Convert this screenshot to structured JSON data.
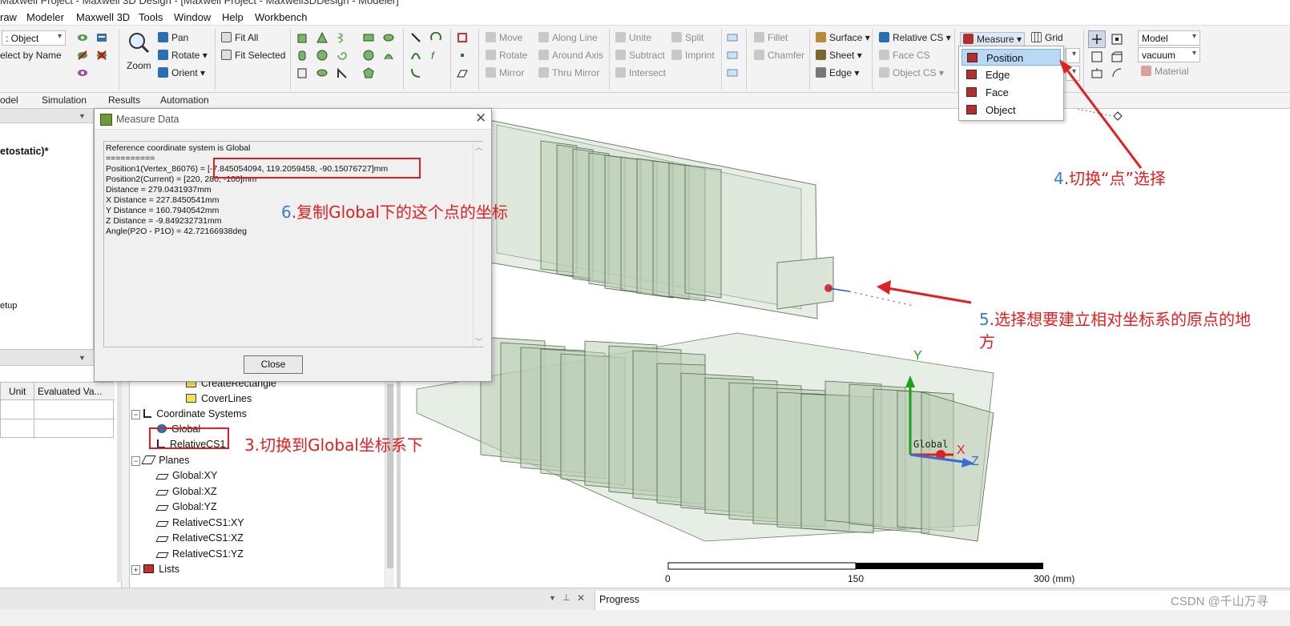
{
  "window": {
    "title": "Maxwell Project - Maxwell 3D Design - [Maxwell Project - Maxwell3DDesign - Modeler]"
  },
  "menu": [
    "raw",
    "Modeler",
    "Maxwell 3D",
    "Tools",
    "Window",
    "Help",
    "Workbench"
  ],
  "ribbon": {
    "select_combo": ": Object",
    "select_by_name": "elect by Name",
    "zoom": "Zoom",
    "pan": "Pan",
    "rotate": "Rotate",
    "orient": "Orient",
    "fit_all": "Fit All",
    "fit_selected": "Fit Selected",
    "move": "Move",
    "rotate2": "Rotate",
    "mirror": "Mirror",
    "along_line": "Along Line",
    "around_axis": "Around Axis",
    "thru_mirror": "Thru Mirror",
    "unite": "Unite",
    "subtract": "Subtract",
    "intersect": "Intersect",
    "split": "Split",
    "imprint": "Imprint",
    "fillet": "Fillet",
    "chamfer": "Chamfer",
    "surface": "Surface",
    "sheet": "Sheet",
    "edge": "Edge",
    "relative_cs": "Relative CS",
    "face_cs": "Face CS",
    "object_cs": "Object CS",
    "measure": "Measure",
    "grid": "Grid",
    "model_combo": "Model",
    "material_combo": "vacuum",
    "material": "Material"
  },
  "tabs": [
    "odel",
    "Simulation",
    "Results",
    "Automation"
  ],
  "left_panel": {
    "project_fragment": "etostatic)*",
    "setup_fragment": "etup",
    "table_headers": [
      "Unit",
      "Evaluated Va..."
    ]
  },
  "measure_dialog": {
    "title": "Measure Data",
    "lines": [
      "Reference coordinate system is Global",
      "==========",
      "Position1(Vertex_86076) = [-7.845054094, 119.2059458, -90.15076727]mm",
      "Position2(Current) = [220, 280, -100]mm",
      "Distance = 279.0431937mm",
      "X Distance = 227.8450541mm",
      "Y Distance = 160.7940542mm",
      "Z Distance = -9.849232731mm",
      "Angle(P2O - P1O) = 42.72166938deg"
    ],
    "close": "Close"
  },
  "measure_menu": {
    "items": [
      "Position",
      "Edge",
      "Face",
      "Object"
    ],
    "selected": "Position"
  },
  "tree": {
    "items": [
      "CreateRectangle",
      "CoverLines",
      "Coordinate Systems",
      "Global",
      "RelativeCS1",
      "Planes",
      "Global:XY",
      "Global:XZ",
      "Global:YZ",
      "RelativeCS1:XY",
      "RelativeCS1:XZ",
      "RelativeCS1:YZ",
      "Lists"
    ]
  },
  "viewport": {
    "axis_y": "Y",
    "axis_x": "X",
    "axis_z": "Z",
    "cs_label": "Global",
    "scale": {
      "ticks": [
        "0",
        "150",
        "300 (mm)"
      ]
    }
  },
  "annotations": {
    "a6_num": "6",
    "a6_text": ".复制Global下的这个点的坐标",
    "a4_num": "4",
    "a4_text": ".切换“点”选择",
    "a5_num": "5",
    "a5_text": ".选择想要建立相对坐标系的原点的地",
    "a5_text2": "方",
    "a3": "3.切换到Global坐标系下"
  },
  "status": {
    "progress": "Progress",
    "watermark": "CSDN @千山万寻"
  },
  "colors": {
    "annotation": "#e02020",
    "annotation_num": "#3a7bd5",
    "model_fill": "#c9d8c4",
    "model_stroke": "#4f6b4a"
  }
}
